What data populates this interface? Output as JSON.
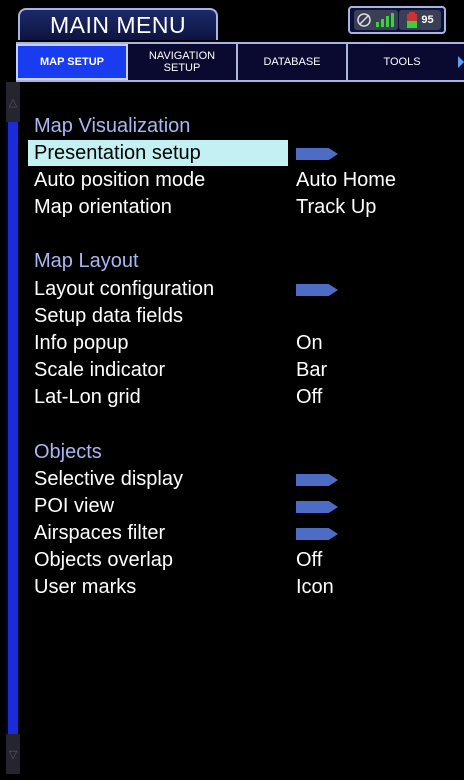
{
  "header": {
    "title": "MAIN MENU",
    "status": {
      "battery_value": "95"
    }
  },
  "tabs": [
    {
      "label": "MAP SETUP",
      "active": true
    },
    {
      "label": "NAVIGATION SETUP",
      "active": false
    },
    {
      "label": "DATABASE",
      "active": false
    },
    {
      "label": "TOOLS",
      "active": false
    }
  ],
  "menu": {
    "sections": [
      {
        "title": "Map Visualization",
        "items": [
          {
            "label": "Presentation setup",
            "value": "",
            "has_submenu": true,
            "selected": true
          },
          {
            "label": "Auto position mode",
            "value": "Auto Home"
          },
          {
            "label": "Map orientation",
            "value": "Track Up"
          }
        ]
      },
      {
        "title": "Map Layout",
        "items": [
          {
            "label": "Layout configuration",
            "value": "",
            "has_submenu": true
          },
          {
            "label": "Setup data fields",
            "value": ""
          },
          {
            "label": "Info popup",
            "value": "On"
          },
          {
            "label": "Scale indicator",
            "value": "Bar"
          },
          {
            "label": "Lat-Lon grid",
            "value": "Off"
          }
        ]
      },
      {
        "title": "Objects",
        "items": [
          {
            "label": "Selective display",
            "value": "",
            "has_submenu": true
          },
          {
            "label": "POI view",
            "value": "",
            "has_submenu": true
          },
          {
            "label": "Airspaces filter",
            "value": "",
            "has_submenu": true
          },
          {
            "label": "Objects overlap",
            "value": "Off"
          },
          {
            "label": "User marks",
            "value": "Icon"
          }
        ]
      }
    ]
  },
  "colors": {
    "active_tab": "#1a3cf0",
    "section_header": "#a8b8f0",
    "selected_row": "#c3f0f2",
    "submenu_arrow": "#4d6dc4",
    "scroll_thumb": "#1a2cd8"
  },
  "icons": {
    "status_signal": "satellite-signal-icon",
    "status_battery": "battery-icon",
    "submenu": "submenu-arrow-icon",
    "scroll_up": "scroll-up-icon",
    "scroll_down": "scroll-down-icon",
    "tab_next": "tab-next-arrow-icon"
  }
}
